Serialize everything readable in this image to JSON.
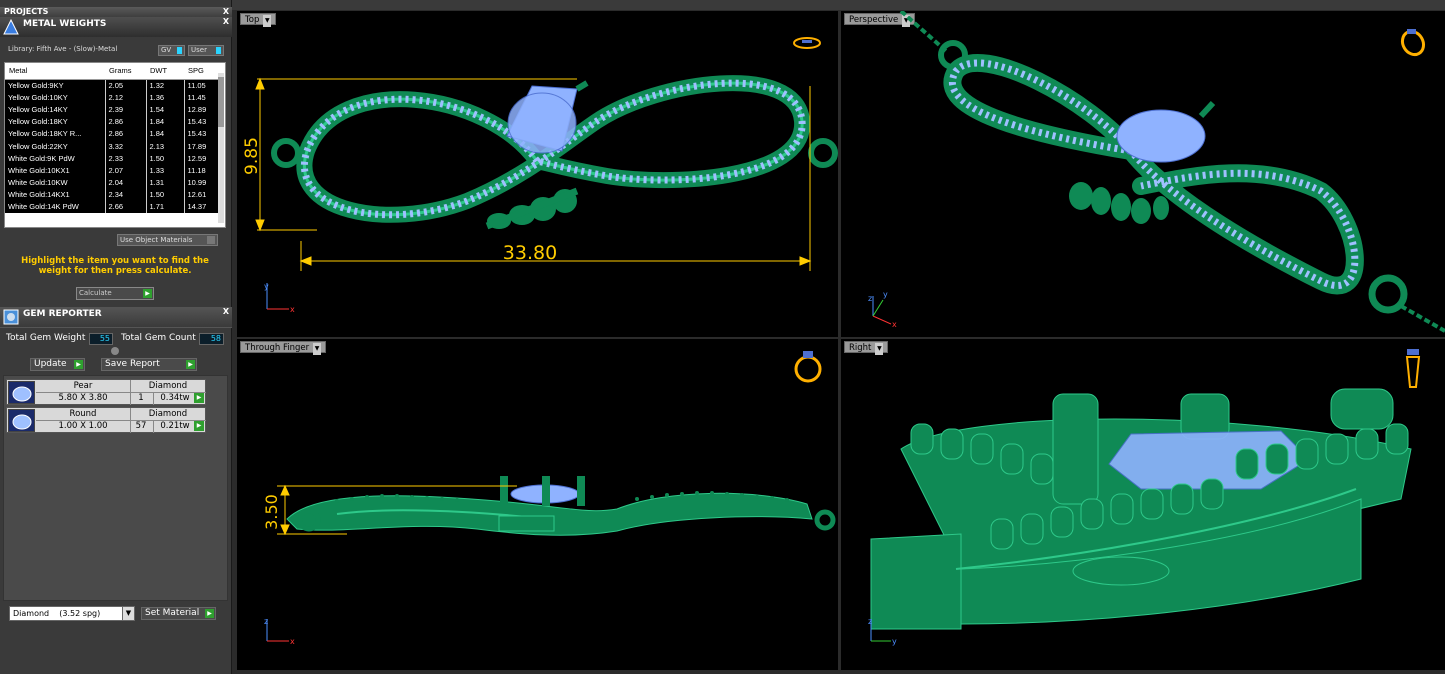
{
  "projects": {
    "title": "PROJECTS",
    "close": "X"
  },
  "metal_weights": {
    "title": "METAL WEIGHTS",
    "close": "X",
    "library": "Library: Fifth Ave - (Slow)-Metal",
    "btn_gv": "GV",
    "btn_user": "User",
    "columns": [
      "Metal",
      "Grams",
      "DWT",
      "SPG"
    ],
    "rows": [
      [
        "Yellow Gold:9KY",
        "2.05",
        "1.32",
        "11.05"
      ],
      [
        "Yellow Gold:10KY",
        "2.12",
        "1.36",
        "11.45"
      ],
      [
        "Yellow Gold:14KY",
        "2.39",
        "1.54",
        "12.89"
      ],
      [
        "Yellow Gold:18KY",
        "2.86",
        "1.84",
        "15.43"
      ],
      [
        "Yellow Gold:18KY R...",
        "2.86",
        "1.84",
        "15.43"
      ],
      [
        "Yellow Gold:22KY",
        "3.32",
        "2.13",
        "17.89"
      ],
      [
        "White Gold:9K PdW",
        "2.33",
        "1.50",
        "12.59"
      ],
      [
        "White Gold:10KX1",
        "2.07",
        "1.33",
        "11.18"
      ],
      [
        "White Gold:10KW",
        "2.04",
        "1.31",
        "10.99"
      ],
      [
        "White Gold:14KX1",
        "2.34",
        "1.50",
        "12.61"
      ],
      [
        "White Gold:14K PdW",
        "2.66",
        "1.71",
        "14.37"
      ]
    ],
    "use_object_materials": "Use Object Materials",
    "message": "Highlight the item you want to find the weight for then press calculate.",
    "calculate": "Calculate"
  },
  "gem_reporter": {
    "title": "GEM REPORTER",
    "close": "X",
    "total_weight_label": "Total Gem Weight",
    "total_weight": "55",
    "total_count_label": "Total Gem Count",
    "total_count": "58",
    "update": "Update",
    "save_report": "Save Report",
    "gems": [
      {
        "shape": "Pear",
        "material": "Diamond",
        "size": "5.80 X 3.80",
        "count": "1",
        "weight": "0.34tw"
      },
      {
        "shape": "Round",
        "material": "Diamond",
        "size": "1.00 X 1.00",
        "count": "57",
        "weight": "0.21tw"
      }
    ],
    "material_select": "Diamond    (3.52 spg)",
    "set_material": "Set Material"
  },
  "viewports": {
    "top": {
      "label": "Top",
      "dim_height": "9.85",
      "dim_width": "33.80"
    },
    "perspective": {
      "label": "Perspective"
    },
    "through_finger": {
      "label": "Through Finger",
      "dim_height": "3.50"
    },
    "right": {
      "label": "Right"
    }
  },
  "axes": {
    "x": "x",
    "y": "y",
    "z": "z"
  },
  "colors": {
    "metal": "#0f8a55",
    "metal_light": "#2ec98a",
    "gem": "#7fa6ff",
    "dim": "#ffcc00"
  }
}
